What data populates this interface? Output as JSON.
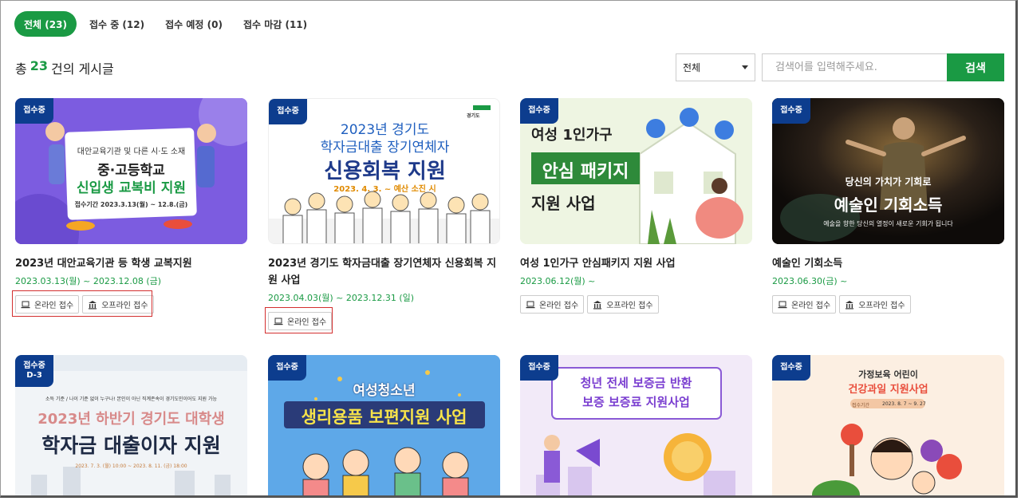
{
  "tabs": [
    {
      "label": "전체 (23)",
      "active": true
    },
    {
      "label": "접수 중 (12)",
      "active": false
    },
    {
      "label": "접수 예정 (0)",
      "active": false
    },
    {
      "label": "접수 마감 (11)",
      "active": false
    }
  ],
  "count": {
    "prefix": "총",
    "number": "23",
    "suffix": "건의 게시글"
  },
  "search": {
    "select_value": "전체",
    "placeholder": "검색어를 입력해주세요.",
    "button": "검색"
  },
  "buttons": {
    "online": "온라인 접수",
    "offline": "오프라인 접수"
  },
  "colors": {
    "accent": "#1a9a44",
    "badge": "#0d3d8e",
    "highlight": "#d32f2f"
  },
  "cards": [
    {
      "badge": "접수중",
      "title": "2023년 대안교육기관 등 학생 교복지원",
      "date": "2023.03.13(월) ~ 2023.12.08 (금)",
      "art": {
        "line1": "대안교육기관 및 다른 시·도 소재",
        "line2": "중·고등학교",
        "line3": "신입생 교복비 지원",
        "line4": "접수기간 2023.3.13(월) ~ 12.8.(금)"
      }
    },
    {
      "badge": "접수중",
      "title": "2023년 경기도 학자금대출 장기연체자 신용회복 지원 사업",
      "date": "2023.04.03(월) ~ 2023.12.31 (일)",
      "art": {
        "logo": "경기도",
        "line1": "2023년 경기도",
        "line2": "학자금대출 장기연체자",
        "line3": "신용회복 지원",
        "line4": "2023. 4. 3. ~ 예산 소진 시"
      }
    },
    {
      "badge": "접수중",
      "title": "여성 1인가구 안심패키지 지원 사업",
      "date": "2023.06.12(월) ~",
      "art": {
        "line1": "여성 1인가구",
        "line2": "안심 패키지",
        "line3": "지원 사업"
      }
    },
    {
      "badge": "접수중",
      "title": "예술인 기회소득",
      "date": "2023.06.30(금) ~",
      "art": {
        "line1": "당신의 가치가 기회로",
        "line2": "예술인 기회소득",
        "line3": "예술을 향한 당신의 열정이 새로운 기회가 됩니다"
      }
    },
    {
      "badge": "접수중",
      "badge2": "D-3",
      "art": {
        "line1": "소득 기준 / 나이 기준 없이 누구나! 본인이 아닌 직계존속이 경기도민이어도 지원 가능",
        "line2": "2023년 하반기 경기도 대학생",
        "line3": "학자금 대출이자 지원",
        "line4": "2023. 7. 3. (월) 10:00 ~ 2023. 8. 11. (금) 18:00"
      }
    },
    {
      "badge": "접수중",
      "art": {
        "line1": "여성청소년",
        "line2": "생리용품 보편지원 사업"
      }
    },
    {
      "badge": "접수중",
      "art": {
        "line1": "청년 전세 보증금 반환",
        "line2": "보증 보증료 지원사업"
      }
    },
    {
      "badge": "접수중",
      "art": {
        "line1": "가정보육 어린이",
        "line2": "건강과일 지원사업",
        "line3": "접수기간",
        "line4": "2023. 8. 7 ~ 9. 27"
      }
    }
  ]
}
